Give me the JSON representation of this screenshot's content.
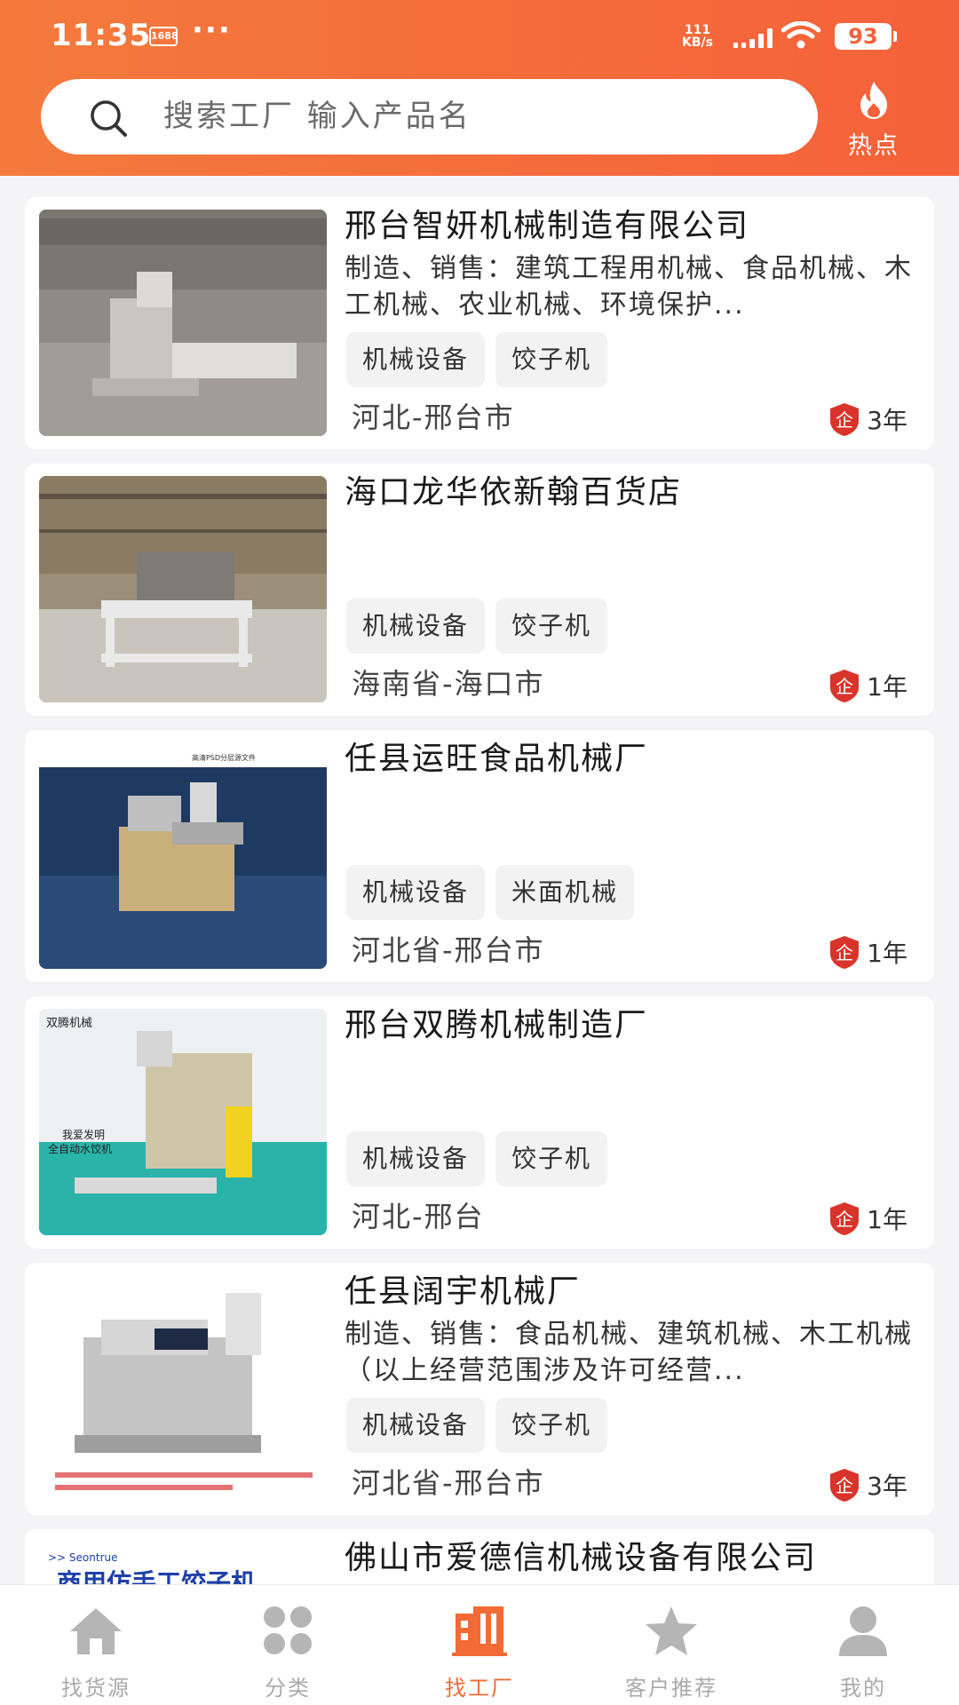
{
  "status_bar": {
    "time": "11:35",
    "app_badge": "1688",
    "dots": "···",
    "net_speed_value": "111",
    "net_speed_unit": "KB/s",
    "battery": "93"
  },
  "search": {
    "placeholder": "搜索工厂 输入产品名",
    "hot_label": "热点"
  },
  "colors": {
    "accent": "#f26a35",
    "header_gradient": [
      "#f47a3c",
      "#f5613a"
    ],
    "badge_red": "#d9342b"
  },
  "factories": [
    {
      "name": "邢台智妍机械制造有限公司",
      "desc": "制造、销售：建筑工程用机械、食品机械、木工机械、农业机械、环境保护...",
      "tags": [
        "机械设备",
        "饺子机"
      ],
      "location": "河北-邢台市",
      "years": "3年",
      "badge": "企"
    },
    {
      "name": "海口龙华依新翰百货店",
      "desc": "",
      "tags": [
        "机械设备",
        "饺子机"
      ],
      "location": "海南省-海口市",
      "years": "1年",
      "badge": "企"
    },
    {
      "name": "任县运旺食品机械厂",
      "desc": "",
      "tags": [
        "机械设备",
        "米面机械"
      ],
      "location": "河北省-邢台市",
      "years": "1年",
      "badge": "企",
      "image_caption": "高清PSD分层源文件"
    },
    {
      "name": "邢台双腾机械制造厂",
      "desc": "",
      "tags": [
        "机械设备",
        "饺子机"
      ],
      "location": "河北-邢台",
      "years": "1年",
      "badge": "企",
      "image_caption": "双腾机械",
      "image_caption_2": "我爱发明",
      "image_caption_3": "全自动水饺机"
    },
    {
      "name": "任县阔宇机械厂",
      "desc": "制造、销售：食品机械、建筑机械、木工机械（以上经营范围涉及许可经营...",
      "tags": [
        "机械设备",
        "饺子机"
      ],
      "location": "河北省-邢台市",
      "years": "3年",
      "badge": "企"
    },
    {
      "name": "佛山市爱德信机械设备有限公司",
      "desc": "",
      "tags": [],
      "location": "",
      "years": "",
      "badge": "",
      "image_caption": "商用仿手工饺子机"
    }
  ],
  "nav": [
    {
      "label": "找货源",
      "icon": "home-icon",
      "active": false
    },
    {
      "label": "分类",
      "icon": "category-icon",
      "active": false
    },
    {
      "label": "找工厂",
      "icon": "factory-icon",
      "active": true
    },
    {
      "label": "客户推荐",
      "icon": "star-icon",
      "active": false
    },
    {
      "label": "我的",
      "icon": "user-icon",
      "active": false
    }
  ]
}
